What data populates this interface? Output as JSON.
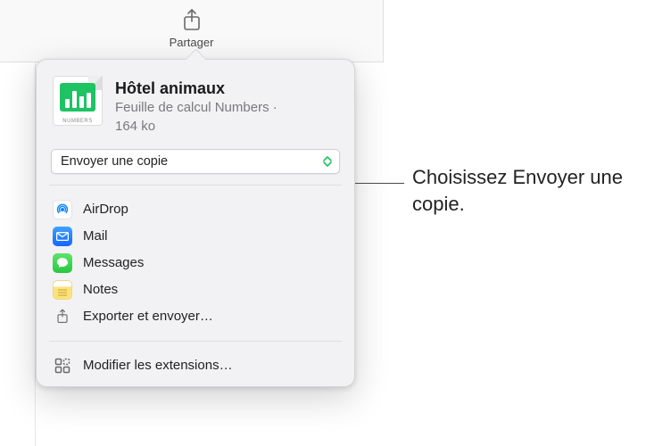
{
  "toolbar": {
    "share_label": "Partager"
  },
  "document": {
    "title": "Hôtel animaux",
    "type_line": "Feuille de calcul Numbers ·",
    "size_line": "164 ko",
    "icon_label": "NUMBERS"
  },
  "mode_select": {
    "label": "Envoyer une copie"
  },
  "share_targets": {
    "airdrop": "AirDrop",
    "mail": "Mail",
    "messages": "Messages",
    "notes": "Notes",
    "export": "Exporter et envoyer…"
  },
  "extensions": {
    "edit_label": "Modifier les extensions…"
  },
  "callout": {
    "text": "Choisissez Envoyer une copie."
  }
}
